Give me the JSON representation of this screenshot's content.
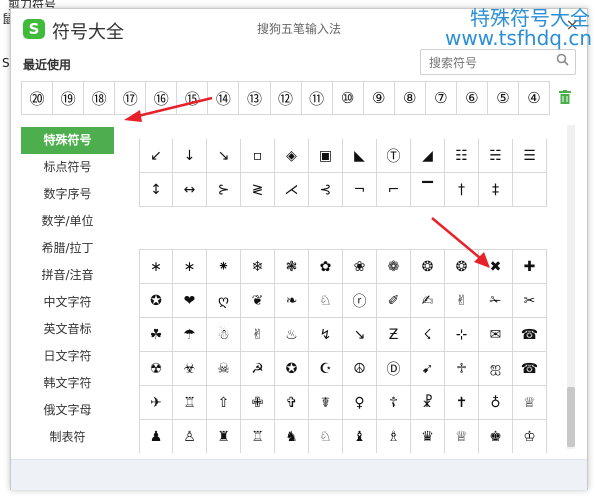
{
  "background": {
    "line1": "剪刀符号",
    "line2": "鼠",
    "line3": "S"
  },
  "watermark": {
    "title": "特殊符号大全",
    "url": "www.tsfhdq.cn"
  },
  "window": {
    "logo_glyph": "S",
    "title": "符号大全",
    "ime_name": "搜狗五笔输入法",
    "close_glyph": "×"
  },
  "recent": {
    "label": "最近使用",
    "items": [
      "⑳",
      "⑲",
      "⑱",
      "⑰",
      "⑯",
      "⑮",
      "⑭",
      "⑬",
      "⑫",
      "⑪",
      "⑩",
      "⑨",
      "⑧",
      "⑦",
      "⑥",
      "⑤",
      "④"
    ]
  },
  "search": {
    "placeholder": "搜索符号"
  },
  "sidebar": {
    "items": [
      "特殊符号",
      "标点符号",
      "数字序号",
      "数学/单位",
      "希腊/拉丁",
      "拼音/注音",
      "中文字符",
      "英文音标",
      "日文字符",
      "韩文字符",
      "俄文字母",
      "制表符"
    ],
    "active_index": 0
  },
  "grid_top": [
    [
      "↙",
      "↓",
      "↘",
      "▫",
      "◈",
      "▣",
      "◣",
      "Ⓣ",
      "◢",
      "☷",
      "☵",
      "☰"
    ],
    [
      "↕",
      "↔",
      "⊱",
      "≷",
      "⋌",
      "⊰",
      "¬",
      "⌐",
      "▔",
      "†",
      "‡",
      ""
    ]
  ],
  "grid_bottom": [
    [
      "∗",
      "∗",
      "⁕",
      "❄",
      "❃",
      "✿",
      "❀",
      "❁",
      "❂",
      "❂",
      "✖",
      "✚"
    ],
    [
      "✪",
      "❤",
      "ღ",
      "❦",
      "❧",
      "♘",
      "ⓡ",
      "✐",
      "✍",
      "✌",
      "✁",
      "✂"
    ],
    [
      "☘",
      "☂",
      "☃",
      "✌",
      "♨",
      "↯",
      "↘",
      "Ƶ",
      "☇",
      "⊹",
      "✉",
      "☎"
    ],
    [
      "☢",
      "☣",
      "☠",
      "☭",
      "✪",
      "☪",
      "☮",
      "Ⓓ",
      "➹",
      "♱",
      "ஐ",
      "☎"
    ],
    [
      "✈",
      "♖",
      "⇧",
      "✙",
      "✞",
      "☤",
      "♀",
      "☦",
      "☧",
      "✝",
      "♁",
      "♕"
    ],
    [
      "♟",
      "♙",
      "♜",
      "♖",
      "♞",
      "♘",
      "♝",
      "♗",
      "♛",
      "♕",
      "♚",
      "♔"
    ]
  ],
  "colors": {
    "accent": "#4cae4c",
    "watermark": "#2a8fd6",
    "arrow": "#e8202a"
  }
}
